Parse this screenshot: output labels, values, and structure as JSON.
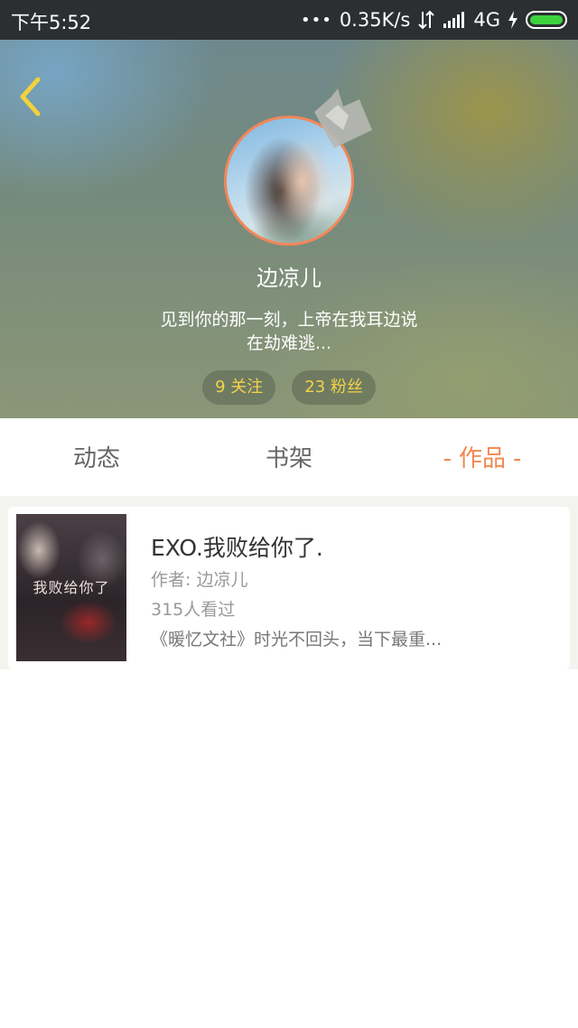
{
  "status_bar": {
    "time": "下午5:52",
    "dots": "•••",
    "network_speed": "0.35K/s",
    "network_type": "4G",
    "battery_color": "#3ed23e"
  },
  "profile": {
    "nickname": "边凉儿",
    "bio_line1": "见到你的那一刻，上帝在我耳边说",
    "bio_line2": "在劫难逃...",
    "following": "9 关注",
    "followers": "23 粉丝",
    "avatar_border_color": "#f2875a"
  },
  "tabs": [
    {
      "label": "动态"
    },
    {
      "label": "书架"
    },
    {
      "label": "作品",
      "active": true,
      "dash": "-"
    }
  ],
  "accent_color": "#f0884f",
  "works": [
    {
      "cover_text": "我败给你了",
      "title": "EXO.我败给你了.",
      "author": "作者: 边凉儿",
      "views": "315人看过",
      "description": "《暖忆文社》时光不回头，当下最重..."
    }
  ],
  "icons": {
    "back": "chevron-left-icon",
    "crown": "crown-icon",
    "signal": "signal-icon",
    "data": "data-arrows-icon",
    "charging": "charging-bolt-icon",
    "battery": "battery-icon"
  }
}
